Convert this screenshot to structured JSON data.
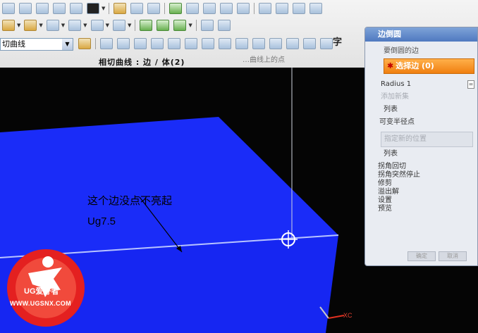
{
  "toolbar": {
    "curve_type": "切曲线",
    "zi_glyph": "字"
  },
  "status": {
    "prompt": "相切曲线 : 边 / 体(2)",
    "secondary": "…曲线上的点"
  },
  "viewport": {
    "annotation": "这个边没点不亮起",
    "version": "Ug7.5",
    "axis_label": "XC"
  },
  "dialog": {
    "title": "边倒圆",
    "section_edges": "要倒圆的边",
    "select_edge": "选择边 (0)",
    "radius_label": "Radius 1",
    "add_new_set": "添加新集",
    "list1": "列表",
    "variable_radius": "可变半径点",
    "specify_point": "指定新的位置",
    "list2": "列表",
    "options": [
      "拐角回切",
      "拐角突然停止",
      "修剪",
      "溢出解",
      "设置",
      "预览"
    ],
    "ok": "确定",
    "cancel": "取消"
  },
  "watermark": {
    "brand": "UG爱好者",
    "url": "WWW.UGSNX.COM"
  },
  "colors": {
    "solid_blue": "#1a2cf8",
    "selection_orange": "#f28c1c",
    "watermark_red": "#e42020"
  }
}
